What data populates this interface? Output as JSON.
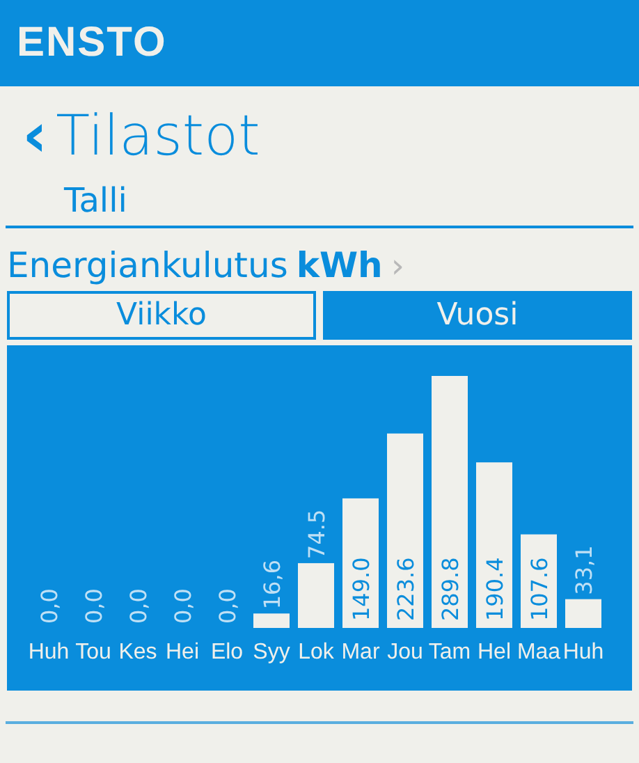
{
  "header": {
    "logo": "ENSTO"
  },
  "page": {
    "back_icon": "‹",
    "title": "Tilastot",
    "subtitle": "Talli"
  },
  "metric": {
    "label": "Energiankulutus",
    "unit": "kWh",
    "chevron": "›"
  },
  "tabs": [
    {
      "label": "Viikko",
      "selected": false
    },
    {
      "label": "Vuosi",
      "selected": true
    }
  ],
  "chart_data": {
    "type": "bar",
    "categories": [
      "Huh",
      "Tou",
      "Kes",
      "Hei",
      "Elo",
      "Syy",
      "Lok",
      "Mar",
      "Jou",
      "Tam",
      "Hel",
      "Maa",
      "Huh"
    ],
    "values": [
      0,
      0,
      0,
      0,
      0,
      16.6,
      74.5,
      149.0,
      223.6,
      289.8,
      190.4,
      107.6,
      33.1
    ],
    "value_labels": [
      "0,0",
      "0,0",
      "0,0",
      "0,0",
      "0,0",
      "16,6",
      "74.5",
      "149.0",
      "223.6",
      "289.8",
      "190.4",
      "107.6",
      "33,1"
    ]
  }
}
